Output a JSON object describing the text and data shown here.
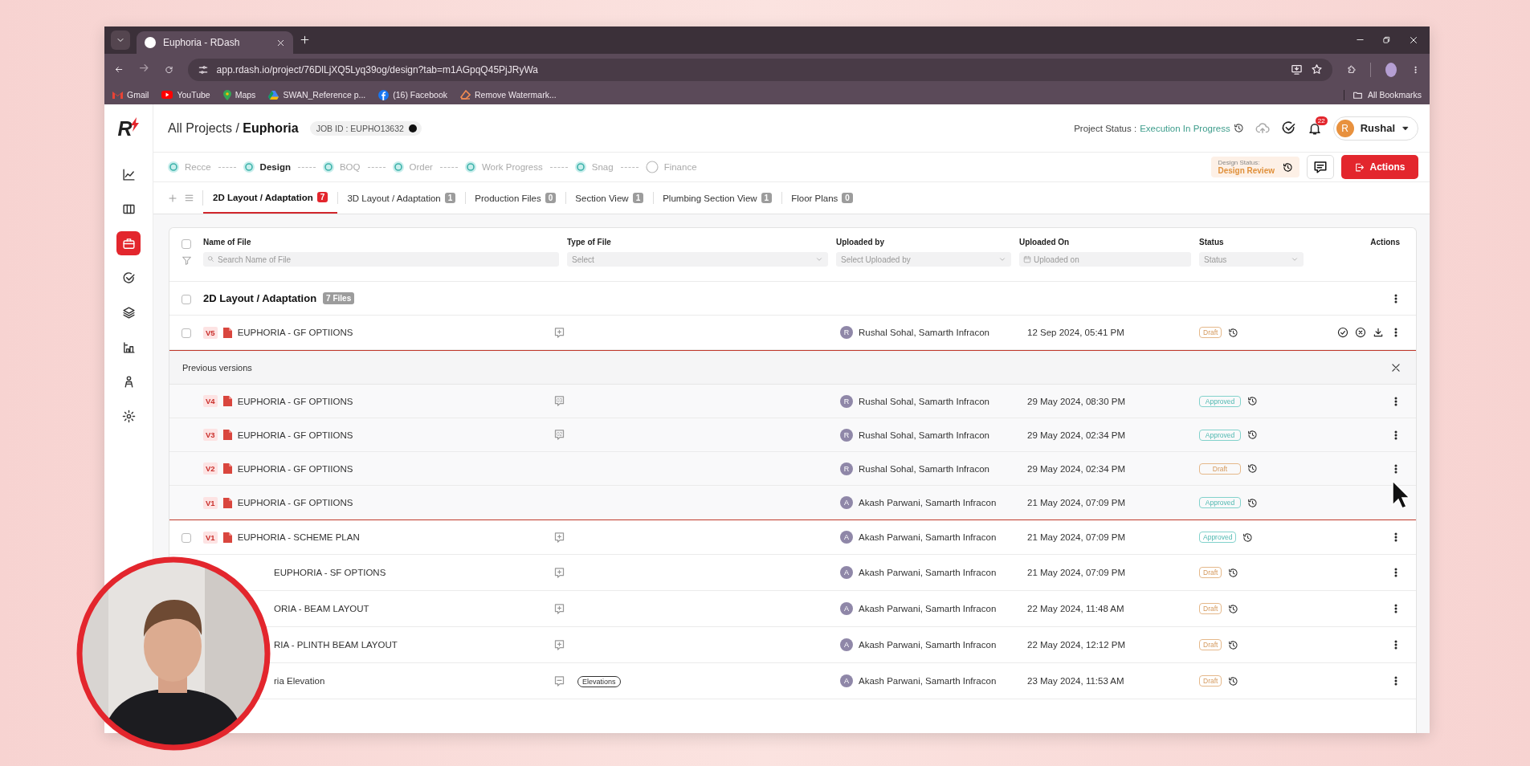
{
  "browser": {
    "tab_title": "Euphoria - RDash",
    "url": "app.rdash.io/project/76DlLjXQ5Lyq39og/design?tab=m1AGpqQ45PjJRyWa",
    "bookmarks": [
      {
        "label": "Gmail"
      },
      {
        "label": "YouTube"
      },
      {
        "label": "Maps"
      },
      {
        "label": "SWAN_Reference  p..."
      },
      {
        "label": "(16) Facebook"
      },
      {
        "label": "Remove Watermark..."
      }
    ],
    "all_bookmarks": "All Bookmarks"
  },
  "sidebar": {
    "logo_text": "R",
    "items": [
      {
        "selected": false
      },
      {
        "selected": false
      },
      {
        "selected": true
      },
      {
        "selected": false
      },
      {
        "selected": false
      },
      {
        "selected": false
      },
      {
        "selected": false
      },
      {
        "selected": false
      }
    ]
  },
  "header": {
    "breadcrumb_root": "All Projects",
    "separator": "/",
    "project": "Euphoria",
    "job_id": "JOB ID : EUPHO13632",
    "project_status_label": "Project Status :",
    "project_status": "Execution In Progress",
    "notifications": "22",
    "user_initial": "R",
    "user_name": "Rushal"
  },
  "stages": [
    {
      "label": "Recce",
      "done": true,
      "selected": false
    },
    {
      "label": "Design",
      "done": true,
      "selected": true
    },
    {
      "label": "BOQ",
      "done": true,
      "selected": false
    },
    {
      "label": "Order",
      "done": true,
      "selected": false
    },
    {
      "label": "Work Progress",
      "done": true,
      "selected": false
    },
    {
      "label": "Snag",
      "done": true,
      "selected": false
    },
    {
      "label": "Finance",
      "done": false,
      "selected": false
    }
  ],
  "design_status": {
    "label": "Design Status:",
    "value": "Design Review"
  },
  "actions_button": "Actions",
  "tabs": [
    {
      "label": "2D Layout / Adaptation",
      "count": "7",
      "selected": true
    },
    {
      "label": "3D Layout / Adaptation",
      "count": "1",
      "selected": false
    },
    {
      "label": "Production Files",
      "count": "0",
      "selected": false
    },
    {
      "label": "Section View",
      "count": "1",
      "selected": false
    },
    {
      "label": "Plumbing Section View",
      "count": "1",
      "selected": false
    },
    {
      "label": "Floor Plans",
      "count": "0",
      "selected": false
    }
  ],
  "table": {
    "checked": false,
    "columns": [
      {
        "label": "Name of File",
        "filter": {
          "placeholder": "Search Name of File",
          "kind": "search"
        }
      },
      {
        "label": "Type of File",
        "filter": {
          "placeholder": "Select",
          "kind": "select"
        }
      },
      {
        "label": "Uploaded by",
        "filter": {
          "placeholder": "Select Uploaded by",
          "kind": "select"
        }
      },
      {
        "label": "Uploaded On",
        "filter": {
          "placeholder": "Uploaded on",
          "kind": "date"
        }
      },
      {
        "label": "Status",
        "filter": {
          "placeholder": "Status",
          "kind": "select"
        }
      },
      {
        "label": "Actions"
      }
    ],
    "group": {
      "title": "2D Layout / Adaptation",
      "count": "7 Files",
      "checked": false
    },
    "rows": [
      {
        "kind": "file",
        "checked": false,
        "version": "V5",
        "name": "EUPHORIA - GF OPTIIONS",
        "comment": {
          "kind": "add"
        },
        "uploader_initial": "R",
        "uploaded_by": "Rushal Sohal, Samarth Infracon",
        "uploaded_on": "12 Sep 2024, 05:41 PM",
        "status": {
          "label": "Draft",
          "kind": "draft"
        },
        "hovered": true,
        "menu": true,
        "expanded": true,
        "versions": {
          "label": "Previous versions",
          "rows": [
            {
              "version": "V4",
              "name": "EUPHORIA - GF OPTIIONS",
              "comment": {
                "kind": "count",
                "count": "03"
              },
              "uploader_initial": "R",
              "uploaded_by": "Rushal Sohal, Samarth Infracon",
              "uploaded_on": "29 May 2024, 08:30 PM",
              "status": {
                "label": "Approved",
                "kind": "approved"
              },
              "menu": true
            },
            {
              "version": "V3",
              "name": "EUPHORIA - GF OPTIIONS",
              "comment": {
                "kind": "count",
                "count": "02"
              },
              "uploader_initial": "R",
              "uploaded_by": "Rushal Sohal, Samarth Infracon",
              "uploaded_on": "29 May 2024, 02:34 PM",
              "status": {
                "label": "Approved",
                "kind": "approved"
              },
              "menu": true
            },
            {
              "version": "V2",
              "name": "EUPHORIA - GF OPTIIONS",
              "uploader_initial": "R",
              "uploaded_by": "Rushal Sohal, Samarth Infracon",
              "uploaded_on": "29 May 2024, 02:34 PM",
              "status": {
                "label": "Draft",
                "kind": "draft"
              },
              "menu": true
            },
            {
              "version": "V1",
              "name": "EUPHORIA - GF OPTIIONS",
              "uploader_initial": "A",
              "uploaded_by": "Akash Parwani, Samarth Infracon",
              "uploaded_on": "21 May 2024, 07:09 PM",
              "status": {
                "label": "Approved",
                "kind": "approved"
              },
              "menu": false
            }
          ]
        }
      },
      {
        "kind": "file",
        "checked": false,
        "version": "V1",
        "name": "EUPHORIA - SCHEME PLAN",
        "comment": {
          "kind": "add"
        },
        "uploader_initial": "A",
        "uploaded_by": "Akash Parwani, Samarth Infracon",
        "uploaded_on": "21 May 2024, 07:09 PM",
        "status": {
          "label": "Approved",
          "kind": "approved"
        },
        "hovered": false,
        "menu": true,
        "expanded": false
      },
      {
        "kind": "clipped",
        "name": "EUPHORIA - SF OPTIONS",
        "comment": {
          "kind": "add"
        },
        "uploader_initial": "A",
        "uploaded_by": "Akash Parwani, Samarth Infracon",
        "uploaded_on": "21 May 2024, 07:09 PM",
        "status": {
          "label": "Draft",
          "kind": "draft"
        },
        "hovered": false,
        "menu": true,
        "expanded": false
      },
      {
        "kind": "clipped",
        "name": "ORIA - BEAM LAYOUT",
        "comment": {
          "kind": "add"
        },
        "uploader_initial": "A",
        "uploaded_by": "Akash Parwani, Samarth Infracon",
        "uploaded_on": "22 May 2024, 11:48 AM",
        "status": {
          "label": "Draft",
          "kind": "draft"
        },
        "hovered": false,
        "menu": true,
        "expanded": false
      },
      {
        "kind": "clipped",
        "name": "RIA - PLINTH BEAM LAYOUT",
        "comment": {
          "kind": "add"
        },
        "uploader_initial": "A",
        "uploaded_by": "Akash Parwani, Samarth Infracon",
        "uploaded_on": "22 May 2024, 12:12 PM",
        "status": {
          "label": "Draft",
          "kind": "draft"
        },
        "hovered": false,
        "menu": true,
        "expanded": false
      },
      {
        "kind": "clipped",
        "name": "ria Elevation",
        "comment": {
          "kind": "empty"
        },
        "type_tag": "Elevations",
        "uploader_initial": "A",
        "uploaded_by": "Akash Parwani, Samarth Infracon",
        "uploaded_on": "23 May 2024, 11:53 AM",
        "status": {
          "label": "Draft",
          "kind": "draft"
        },
        "hovered": false,
        "menu": true,
        "expanded": false
      }
    ]
  }
}
